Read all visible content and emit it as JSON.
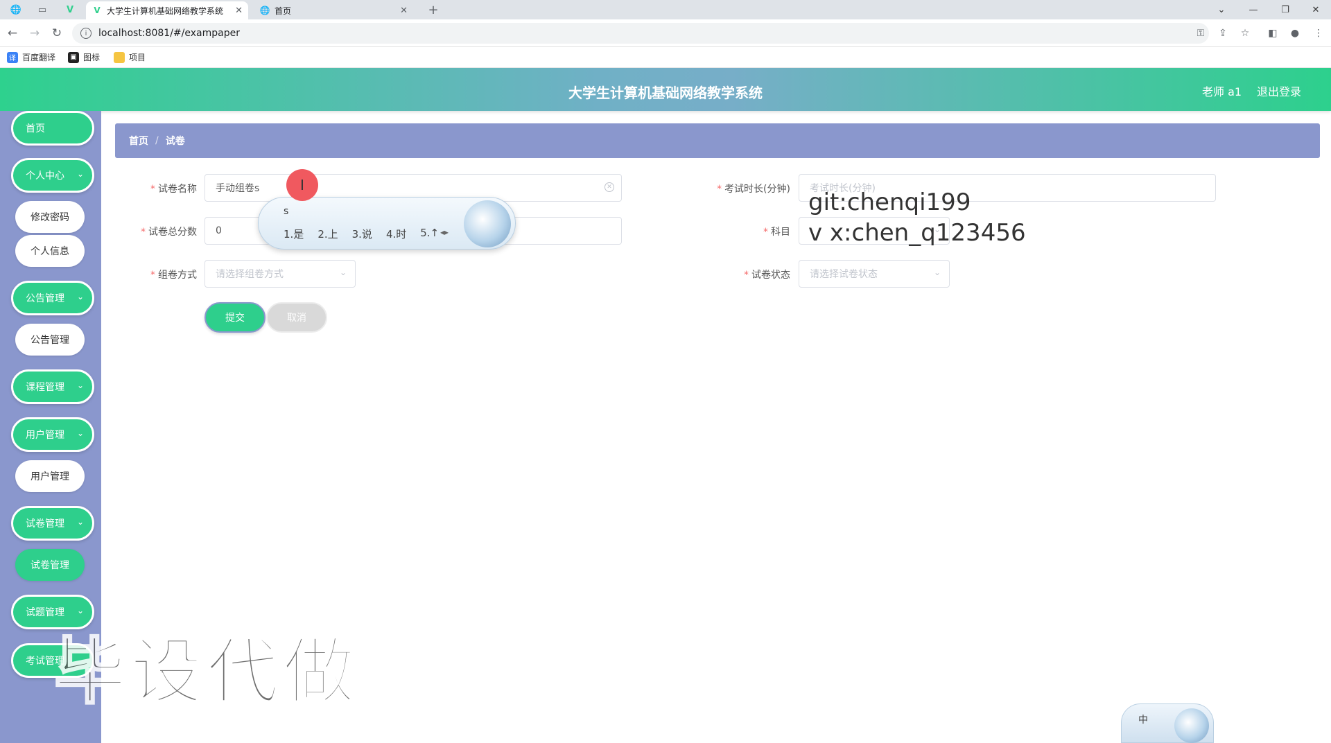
{
  "browser": {
    "tabs": [
      {
        "title": "大学生计算机基础网络教学系统",
        "active": true
      },
      {
        "title": "首页",
        "active": false
      }
    ],
    "new_tab": "+",
    "url": "localhost:8081/#/exampaper",
    "bookmarks": [
      "百度翻译",
      "图标",
      "项目"
    ]
  },
  "header": {
    "title": "大学生计算机基础网络教学系统",
    "user": "老师 a1",
    "logout": "退出登录"
  },
  "sidebar": {
    "items": [
      {
        "label": "首页"
      },
      {
        "label": "个人中心",
        "children": [
          "修改密码",
          "个人信息"
        ]
      },
      {
        "label": "公告管理",
        "children": [
          "公告管理"
        ]
      },
      {
        "label": "课程管理"
      },
      {
        "label": "用户管理",
        "children": [
          "用户管理"
        ]
      },
      {
        "label": "试卷管理",
        "children": [
          "试卷管理"
        ]
      },
      {
        "label": "试题管理"
      },
      {
        "label": "考试管理"
      }
    ],
    "active_child": "试卷管理"
  },
  "breadcrumb": [
    "首页",
    "试卷"
  ],
  "form": {
    "paper_name": {
      "label": "试卷名称",
      "value": "手动组卷s"
    },
    "duration": {
      "label": "考试时长(分钟)",
      "placeholder": "考试时长(分钟)"
    },
    "total_score": {
      "label": "试卷总分数",
      "value": "0"
    },
    "subject": {
      "label": "科目"
    },
    "compose_method": {
      "label": "组卷方式",
      "placeholder": "请选择组卷方式"
    },
    "status": {
      "label": "试卷状态",
      "placeholder": "请选择试卷状态"
    },
    "submit": "提交",
    "cancel": "取消"
  },
  "ime": {
    "composition": "s",
    "candidates": [
      "1.是",
      "2.上",
      "3.说",
      "4.时",
      "5.↑"
    ],
    "mini_label": "中"
  },
  "overlay": {
    "line1": "git:chenqi199",
    "line2": "v x:chen_q123456",
    "watermark": "毕设代做"
  }
}
